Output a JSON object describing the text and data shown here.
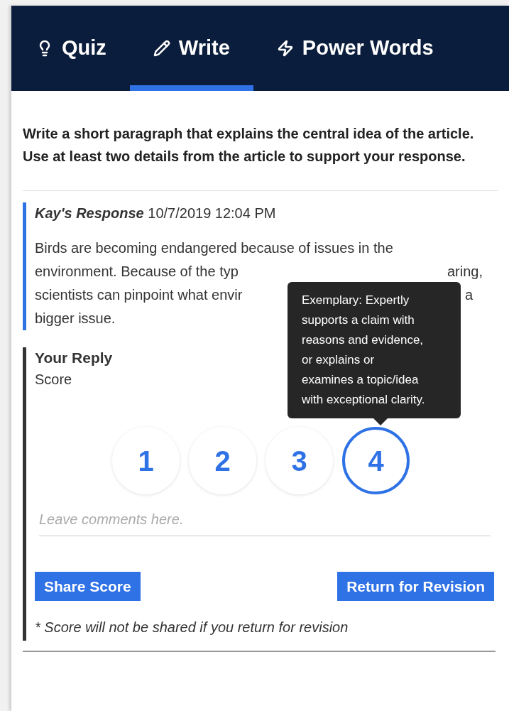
{
  "tabs": [
    {
      "label": "Quiz",
      "selected": false
    },
    {
      "label": "Write",
      "selected": true
    },
    {
      "label": "Power Words",
      "selected": false
    }
  ],
  "prompt": "Write a short paragraph that explains the central idea of the article. Use at least two details from the article to support your response.",
  "response": {
    "author": "Kay's Response",
    "timestamp": "10/7/2019 12:04 PM",
    "lines": [
      {
        "left": "Birds are becoming endangered because of issues in the"
      },
      {
        "left": "environment. Because of the typ",
        "right": "aring,"
      },
      {
        "left": "scientists can pinpoint what envir",
        "right": "a"
      },
      {
        "left": "bigger issue."
      }
    ]
  },
  "reply": {
    "title": "Your Reply",
    "score_label": "Score",
    "scores": [
      {
        "label": "1",
        "selected": false
      },
      {
        "label": "2",
        "selected": false
      },
      {
        "label": "3",
        "selected": false
      },
      {
        "label": "4",
        "selected": true
      }
    ],
    "tooltip": [
      "Exemplary: Expertly",
      "supports a claim with",
      "reasons and evidence,",
      "or explains or",
      "examines a topic/idea",
      "with exceptional clarity."
    ],
    "comment_placeholder": "Leave comments here.",
    "buttons": [
      "Share Score",
      "Return for Revision"
    ],
    "note": "* Score will not be shared if you return for revision"
  }
}
